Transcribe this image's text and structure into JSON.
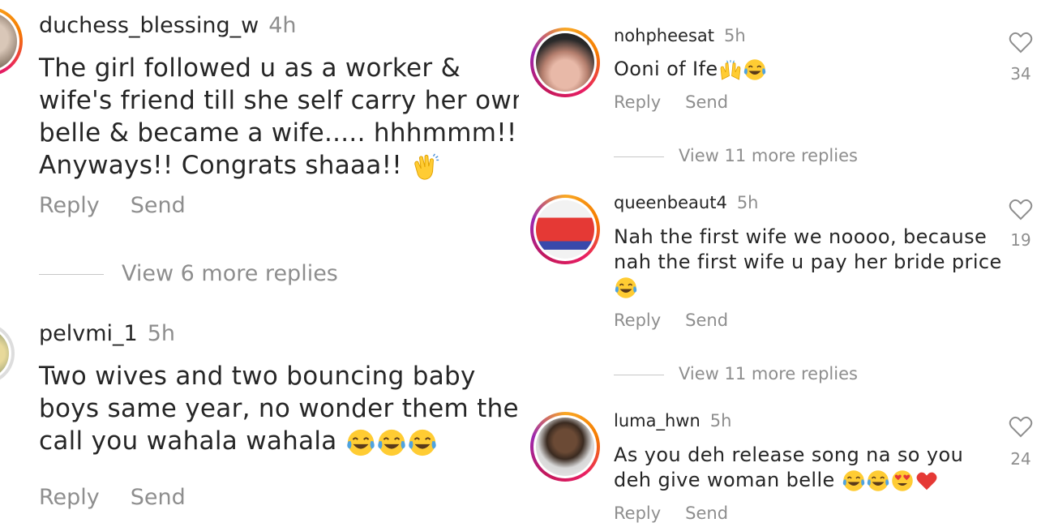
{
  "left_comments": [
    {
      "username": "duchess_blessing_w",
      "time": "4h",
      "text_lines": [
        "The girl followed u as a worker &",
        "wife's friend till she self carry her own",
        "belle & became a wife..... hhhmmm!!!",
        "Anyways!! Congrats shaaa!! "
      ],
      "emojis": [
        "clapping-hands"
      ],
      "reply_label": "Reply",
      "send_label": "Send",
      "view_more": "View 6 more replies"
    },
    {
      "username": "pelvmi_1",
      "time": "5h",
      "text_lines": [
        "Two wives and two bouncing baby",
        "boys same year, no wonder them they",
        "call you wahala wahala "
      ],
      "emojis": [
        "tears-of-joy",
        "tears-of-joy",
        "tears-of-joy"
      ],
      "reply_label": "Reply",
      "send_label": "Send"
    }
  ],
  "right_comments": [
    {
      "username": "nohpheesat",
      "time": "5h",
      "text_lines": [
        "Ooni of Ife"
      ],
      "emojis": [
        "raising-hands",
        "tears-of-joy"
      ],
      "likes": "34",
      "reply_label": "Reply",
      "send_label": "Send",
      "view_more": "View 11 more replies"
    },
    {
      "username": "queenbeaut4",
      "time": "5h",
      "text_lines": [
        "Nah the first wife we noooo, because",
        "nah the first wife u pay her bride price",
        ""
      ],
      "emojis": [
        "tears-of-joy"
      ],
      "likes": "19",
      "reply_label": "Reply",
      "send_label": "Send",
      "view_more": "View 11 more replies"
    },
    {
      "username": "luma_hwn",
      "time": "5h",
      "text_lines": [
        "As you deh release song na so you",
        "deh give woman belle "
      ],
      "emojis": [
        "tears-of-joy",
        "tears-of-joy",
        "heart-eyes",
        "red-heart"
      ],
      "likes": "24",
      "reply_label": "Reply",
      "send_label": "Send"
    }
  ],
  "colors": {
    "primary_text": "#262626",
    "secondary_text": "#8e8e8e",
    "story_ring": [
      "#f9a825",
      "#e91e63",
      "#9c27b0"
    ],
    "emoji_yellow": "#ffcc33",
    "heart_red": "#e53935"
  }
}
